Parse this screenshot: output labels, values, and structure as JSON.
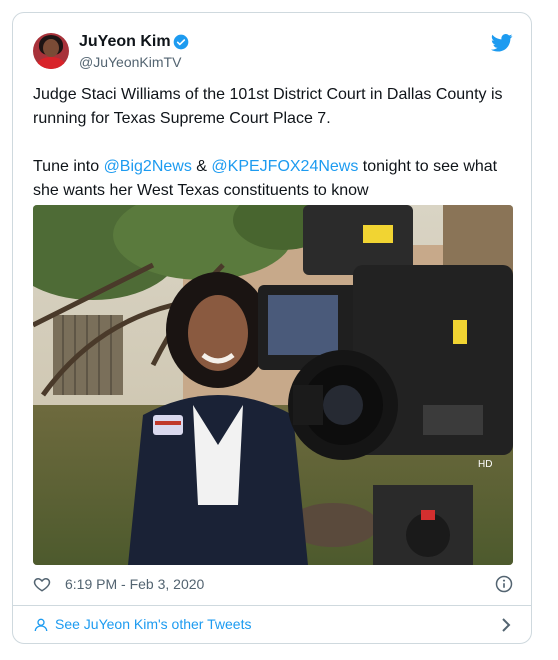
{
  "author": {
    "name": "JuYeon Kim",
    "handle": "@JuYeonKimTV"
  },
  "tweet": {
    "line1": "Judge Staci Williams of the 101st District Court in Dallas County is running for Texas Supreme Court Place 7.",
    "line2_prefix": "Tune into ",
    "mention1": "@Big2News",
    "amp": " & ",
    "mention2": "@KPEJFOX24News",
    "line2_suffix": "  tonight to see what she wants her West Texas constituents to know"
  },
  "meta": {
    "timestamp": "6:19 PM - Feb 3, 2020"
  },
  "footer": {
    "more_tweets": "See JuYeon Kim's other Tweets"
  },
  "media": {
    "camera_label": "HD",
    "badge_text": "Staci Williams"
  },
  "colors": {
    "brand": "#1d9bf0",
    "text": "#0f1419",
    "muted": "#536471"
  },
  "icons": [
    "verified-badge-icon",
    "twitter-bird-icon",
    "heart-icon",
    "info-icon",
    "person-icon",
    "chevron-right-icon"
  ]
}
